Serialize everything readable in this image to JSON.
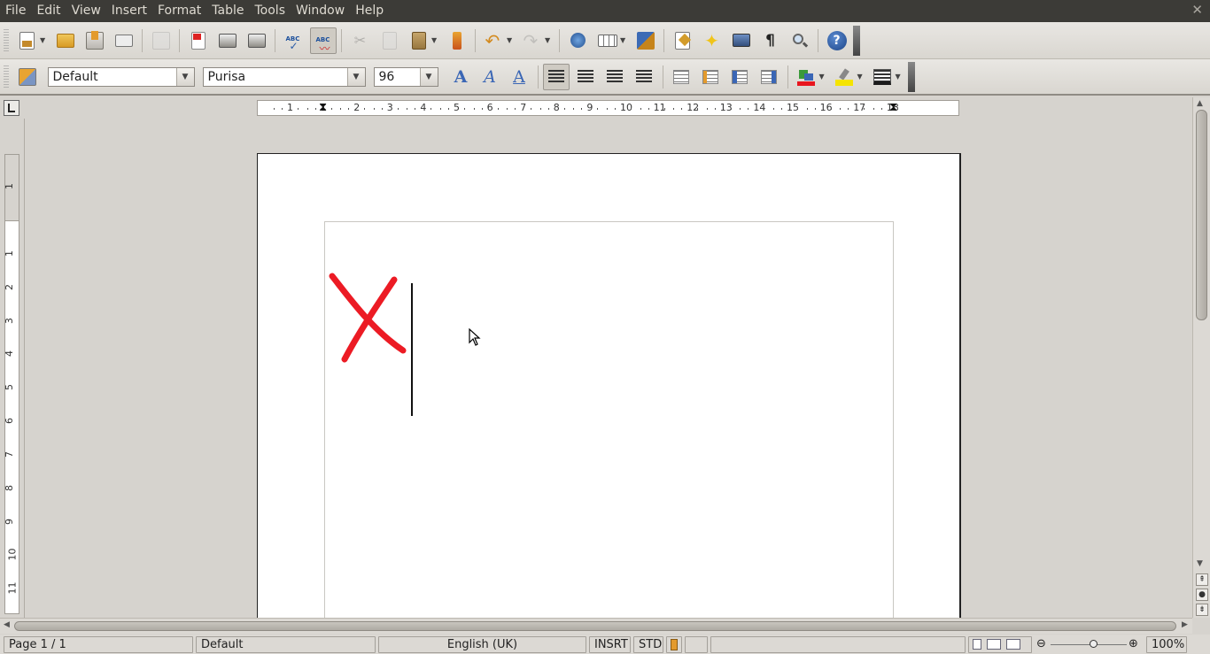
{
  "menu": [
    "File",
    "Edit",
    "View",
    "Insert",
    "Format",
    "Table",
    "Tools",
    "Window",
    "Help"
  ],
  "window_close": "✕",
  "toolbar": {
    "standard_buttons": [
      "New",
      "Open",
      "Save",
      "Document as E-mail",
      "Edit File",
      "Export Directly as PDF",
      "Print File Directly",
      "Page Preview",
      "Spelling and Grammar",
      "AutoSpellcheck",
      "Cut",
      "Copy",
      "Paste",
      "Clone Formatting",
      "Undo",
      "Redo",
      "Hyperlink",
      "Table",
      "Show Draw Functions",
      "Find & Replace",
      "Navigator",
      "Gallery",
      "Formatting Marks",
      "Zoom",
      "Help"
    ],
    "pilcrow": "¶",
    "help_glyph": "?"
  },
  "formatting": {
    "paragraph_style": "Default",
    "font_name": "Purisa",
    "font_size": "96",
    "font_color": "#e8161f",
    "highlight_color": "#f5e400"
  },
  "ruler_h_labels": [
    "1",
    "1",
    "2",
    "3",
    "4",
    "5",
    "6",
    "7",
    "8",
    "9",
    "10",
    "11",
    "12",
    "13",
    "14",
    "15",
    "16",
    "17",
    "18"
  ],
  "ruler_v_labels": [
    "1",
    "1",
    "2",
    "3",
    "4",
    "5",
    "6",
    "7",
    "8",
    "9",
    "10",
    "11"
  ],
  "document": {
    "content_color": "#ec1b24"
  },
  "status": {
    "page": "Page 1 / 1",
    "page_style": "Default",
    "language": "English (UK)",
    "insert_mode": "INSRT",
    "selection_mode": "STD",
    "zoom": "100%"
  }
}
